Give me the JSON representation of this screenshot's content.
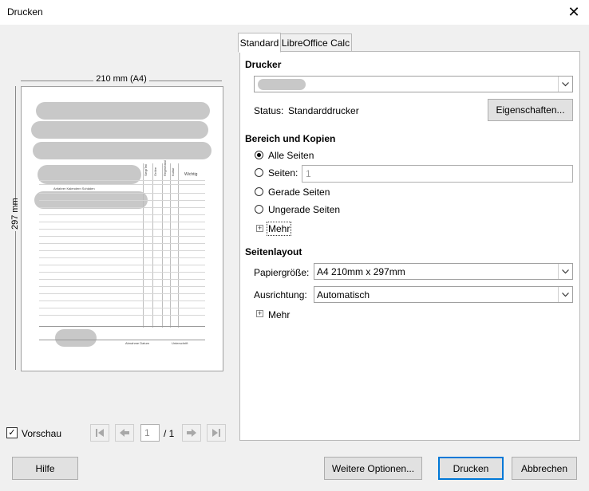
{
  "window": {
    "title": "Drucken",
    "close_glyph": "✕"
  },
  "preview": {
    "width_label": "210 mm (A4)",
    "height_label": "297 mm",
    "sheet": {
      "col1": "Sieg/Teil",
      "col2": "Gröbe",
      "col3": "Regel/lokal",
      "col4": "Kultur",
      "col5": "Wichtig",
      "row_label": "Anfahrer Kalendern Schäden",
      "foot_sign": "Unterschrift",
      "foot_date": "Abnahme Datum"
    },
    "checkbox_label": "Vorschau",
    "checkbox_checked": true,
    "page_current": "1",
    "page_total": "/ 1"
  },
  "tabs": [
    "Standard",
    "LibreOffice Calc"
  ],
  "printer": {
    "heading": "Drucker",
    "selected": "",
    "status_label": "Status:",
    "status_value": "Standarddrucker",
    "properties_button": "Eigenschaften..."
  },
  "range": {
    "heading": "Bereich und Kopien",
    "options": [
      "Alle Seiten",
      "Seiten:",
      "Gerade Seiten",
      "Ungerade Seiten"
    ],
    "selected_index": 0,
    "pages_value": "1",
    "more": "Mehr"
  },
  "layout": {
    "heading": "Seitenlayout",
    "paper_label": "Papiergröße:",
    "paper_value": "A4 210mm x 297mm",
    "orientation_label": "Ausrichtung:",
    "orientation_value": "Automatisch",
    "more": "Mehr"
  },
  "buttons": {
    "help": "Hilfe",
    "more_options": "Weitere Optionen...",
    "print": "Drucken",
    "cancel": "Abbrechen"
  }
}
